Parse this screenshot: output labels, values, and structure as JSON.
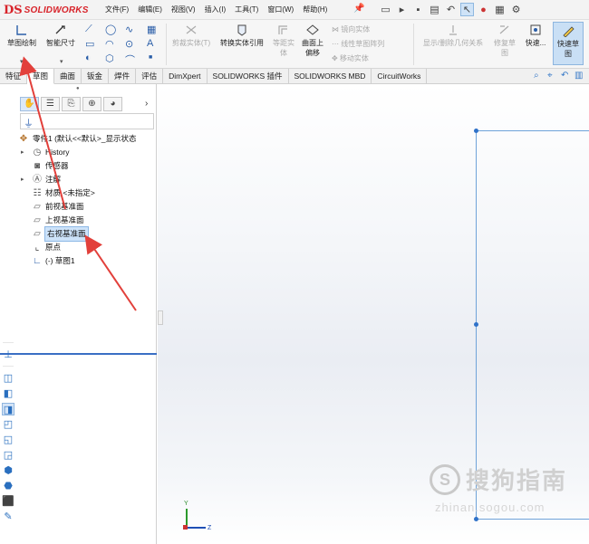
{
  "app": {
    "logo_mark": "DS",
    "brand": "SOLIDWORKS"
  },
  "menu": [
    "文件(F)",
    "编辑(E)",
    "视图(V)",
    "插入(I)",
    "工具(T)",
    "窗口(W)",
    "帮助(H)"
  ],
  "ribbon": {
    "sketch": "草图绘制",
    "smart_dim": "智能尺寸",
    "trim": "剪裁实体(T)",
    "convert": "转换实体引用",
    "offset_equal": "等距实",
    "offset_equal2": "体",
    "offset_surface": "曲面上",
    "offset_surface2": "偏移",
    "mirror": "镜向实体",
    "linear_pattern": "线性草图阵列",
    "move": "移动实体",
    "relations": "显示/删除几何关系",
    "repair": "修复草",
    "repair2": "图",
    "quick": "快速...",
    "quick_sketch": "快速草",
    "quick_sketch2": "图"
  },
  "tabs": [
    "特征",
    "草图",
    "曲面",
    "钣金",
    "焊件",
    "评估",
    "DimXpert",
    "SOLIDWORKS 插件",
    "SOLIDWORKS MBD",
    "CircuitWorks"
  ],
  "active_tab": "草图",
  "tree": {
    "root": "零件1 (默认<<默认>_显示状态",
    "items": [
      {
        "label": "History",
        "expandable": true
      },
      {
        "label": "传感器",
        "expandable": false
      },
      {
        "label": "注解",
        "expandable": true
      },
      {
        "label": "材质 <未指定>",
        "expandable": false
      },
      {
        "label": "前视基准面",
        "expandable": false
      },
      {
        "label": "上视基准面",
        "expandable": false
      },
      {
        "label": "右视基准面",
        "expandable": false,
        "selected": true
      },
      {
        "label": "原点",
        "expandable": false
      },
      {
        "label": "(-) 草图1",
        "expandable": false
      }
    ]
  },
  "triad": {
    "y": "Y",
    "z": "Z"
  },
  "watermark": {
    "logo": "S",
    "text": "搜狗指南",
    "url": "zhinan.sogou.com"
  },
  "colors": {
    "accent": "#d8232a",
    "selection": "#cde3fa",
    "sketch_line": "#6fa3d9",
    "annotation_arrow": "#e2403b"
  }
}
